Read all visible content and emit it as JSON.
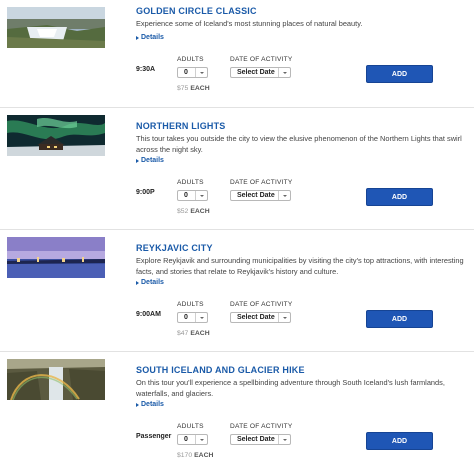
{
  "labels": {
    "details": "Details",
    "adults": "ADULTS",
    "date_of_activity": "DATE OF ACTIVITY",
    "add": "ADD",
    "each": "EACH"
  },
  "tours": [
    {
      "title": "GOLDEN CIRCLE CLASSIC",
      "description": "Experience some of Iceland's most stunning places of natural beauty.",
      "time": "9:30A",
      "qty": "0",
      "date_value": "Select Date",
      "price": "$75",
      "image": "waterfall-landscape"
    },
    {
      "title": "NORTHERN LIGHTS",
      "description": "This tour takes you outside the city to view the elusive phenomenon of the Northern Lights that swirl across the night sky.",
      "time": "9:00P",
      "qty": "0",
      "date_value": "Select Date",
      "price": "$52",
      "image": "aurora-over-cabin"
    },
    {
      "title": "REYKJAVIC CITY",
      "description": "Explore Reykjavik and surrounding municipalities by visiting the city's top attractions, with interesting facts, and stories that relate to Reykjavik's history and culture.",
      "time": "9:00AM",
      "qty": "0",
      "date_value": "Select Date",
      "price": "$47",
      "image": "city-skyline-dusk"
    },
    {
      "title": "SOUTH ICELAND AND GLACIER HIKE",
      "description": "On this tour you'll experience a spellbinding adventure through South Iceland's lush farmlands, waterfalls, and glaciers.",
      "time": "Passenger",
      "qty": "0",
      "date_value": "Select Date",
      "price": "$170",
      "image": "waterfall-rainbow"
    }
  ],
  "colors": {
    "accent": "#1a5aa8",
    "button": "#1f56b5"
  }
}
